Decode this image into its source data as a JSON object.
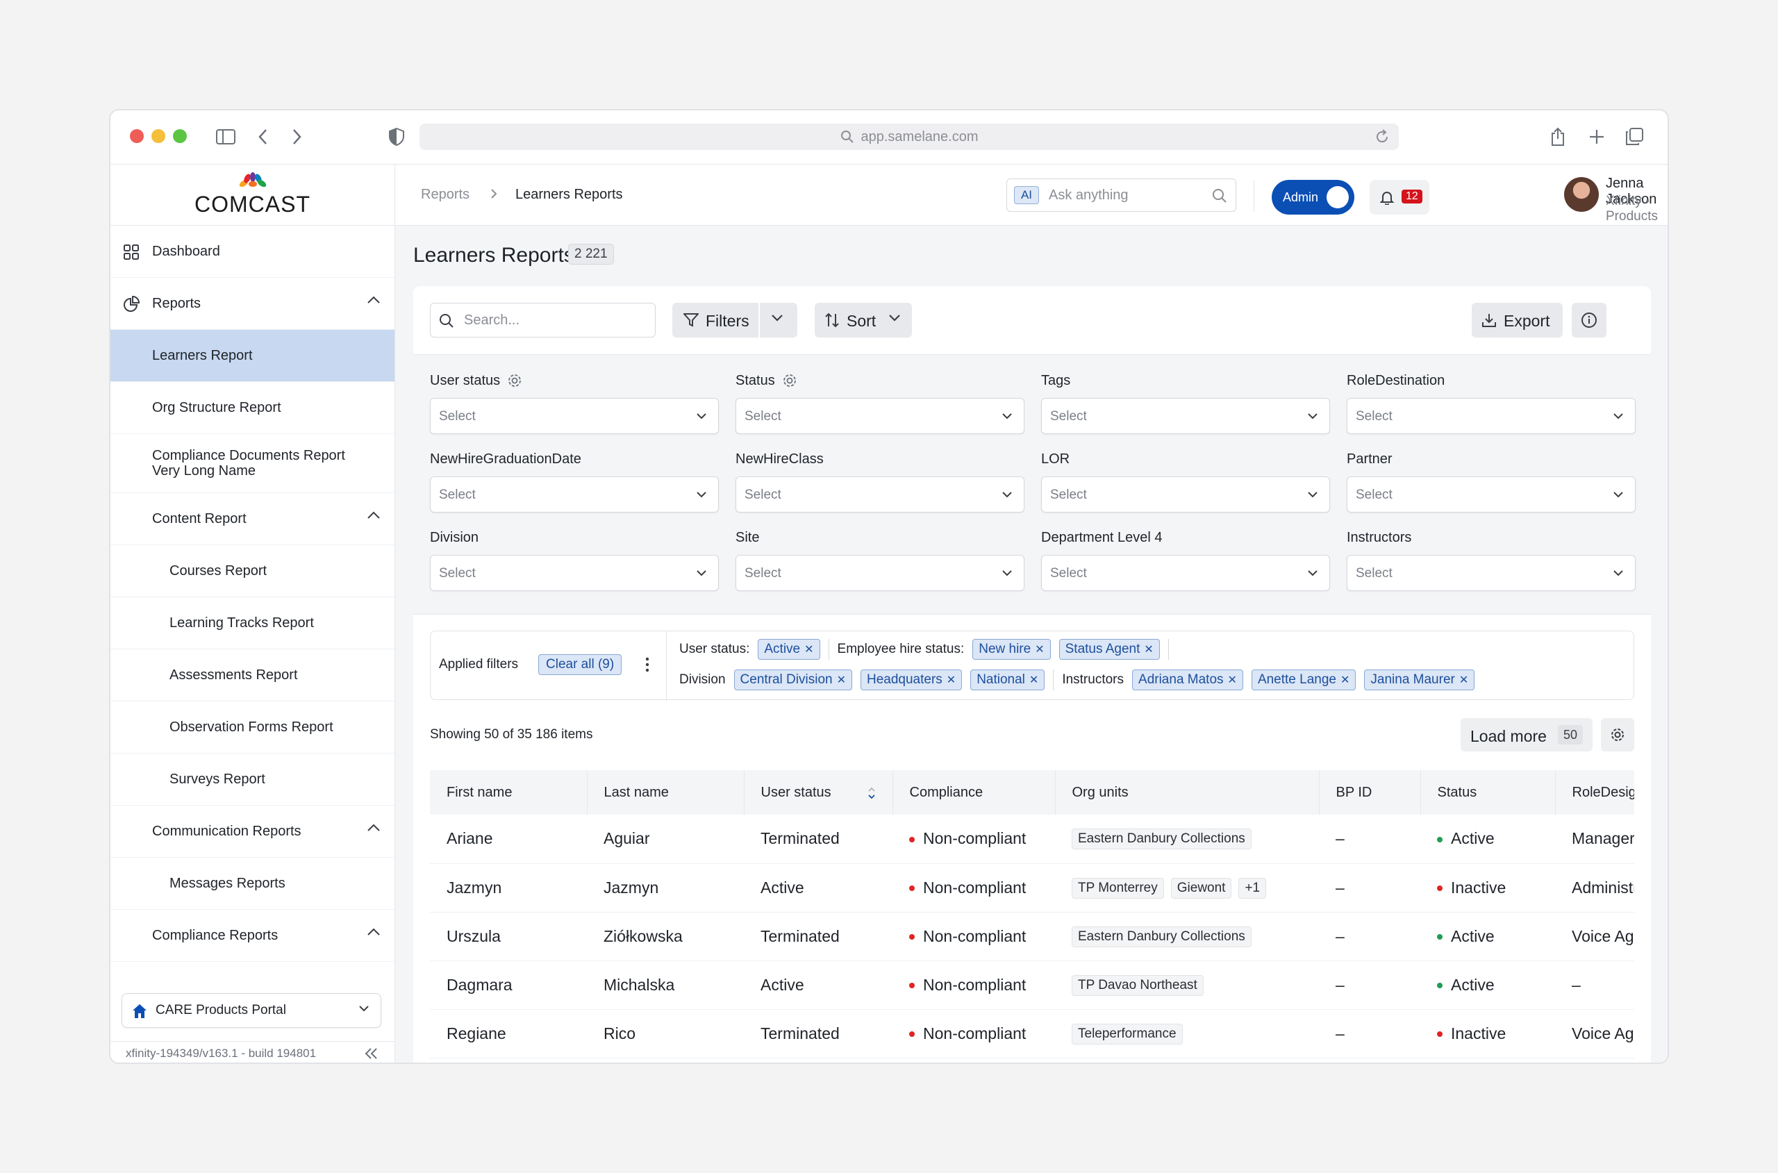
{
  "browser": {
    "url": "app.samelane.com"
  },
  "brand": {
    "logo_text": "COMCAST"
  },
  "sidebar": {
    "items": [
      {
        "label": "Dashboard"
      },
      {
        "label": "Reports"
      },
      {
        "label": "Learners Report"
      },
      {
        "label": "Org Structure Report"
      },
      {
        "label": "Compliance Documents Report Very Long Name"
      },
      {
        "label": "Content Report"
      },
      {
        "label": "Courses Report"
      },
      {
        "label": "Learning Tracks Report"
      },
      {
        "label": "Assessments Report"
      },
      {
        "label": "Observation Forms Report"
      },
      {
        "label": "Surveys Report"
      },
      {
        "label": "Communication Reports"
      },
      {
        "label": "Messages Reports"
      },
      {
        "label": "Compliance Reports"
      }
    ],
    "portal": "CARE Products Portal",
    "build": "xfinity-194349/v163.1 - build 194801"
  },
  "header": {
    "breadcrumb": [
      "Reports",
      "Learners Reports"
    ],
    "ask_placeholder": "Ask anything",
    "ai_badge": "AI",
    "admin_label": "Admin",
    "notifications": "12",
    "user_name": "Jenna Jackson",
    "user_org": "Xfinity - Products"
  },
  "page": {
    "title": "Learners Reports",
    "count": "2 221"
  },
  "toolbar": {
    "search_placeholder": "Search...",
    "filters": "Filters",
    "sort": "Sort",
    "export": "Export"
  },
  "filters": [
    {
      "label": "User status",
      "value": "Select"
    },
    {
      "label": "Status",
      "value": "Select"
    },
    {
      "label": "Tags",
      "value": "Select"
    },
    {
      "label": "RoleDestination",
      "value": "Select"
    },
    {
      "label": "NewHireGraduationDate",
      "value": "Select"
    },
    {
      "label": "NewHireClass",
      "value": "Select"
    },
    {
      "label": "LOR",
      "value": "Select"
    },
    {
      "label": "Partner",
      "value": "Select"
    },
    {
      "label": "Division",
      "value": "Select"
    },
    {
      "label": "Site",
      "value": "Select"
    },
    {
      "label": "Department Level 4",
      "value": "Select"
    },
    {
      "label": "Instructors",
      "value": "Select"
    }
  ],
  "applied": {
    "label": "Applied filters",
    "clear": "Clear all (9)",
    "user_status_key": "User status:",
    "user_status": [
      "Active"
    ],
    "hire_key": "Employee hire status:",
    "hire": [
      "New hire",
      "Status Agent"
    ],
    "division_key": "Division",
    "division": [
      "Central Division",
      "Headquaters",
      "National"
    ],
    "instructors_key": "Instructors",
    "instructors": [
      "Adriana Matos",
      "Anette Lange",
      "Janina Maurer"
    ]
  },
  "results": {
    "showing": "Showing 50 of 35 186 items",
    "load_more": "Load more",
    "load_count": "50"
  },
  "table": {
    "columns": [
      "First name",
      "Last name",
      "User status",
      "Compliance",
      "Org units",
      "BP ID",
      "Status",
      "RoleDesignation"
    ],
    "rows": [
      {
        "first": "Ariane",
        "last": "Aguiar",
        "user_status": "Terminated",
        "compliance": "Non-compliant",
        "org": [
          "Eastern Danbury Collections"
        ],
        "bp": "–",
        "status": "Active",
        "status_color": "#1f9d55",
        "role": "Manager"
      },
      {
        "first": "Jazmyn",
        "last": "Jazmyn",
        "user_status": "Active",
        "compliance": "Non-compliant",
        "org": [
          "TP Monterrey",
          "Giewont",
          "+1"
        ],
        "bp": "–",
        "status": "Inactive",
        "status_color": "#e02424",
        "role": "Administrator"
      },
      {
        "first": "Urszula",
        "last": "Ziółkowska",
        "user_status": "Terminated",
        "compliance": "Non-compliant",
        "org": [
          "Eastern Danbury Collections"
        ],
        "bp": "–",
        "status": "Active",
        "status_color": "#1f9d55",
        "role": "Voice Agent"
      },
      {
        "first": "Dagmara",
        "last": "Michalska",
        "user_status": "Active",
        "compliance": "Non-compliant",
        "org": [
          "TP Davao Northeast"
        ],
        "bp": "–",
        "status": "Active",
        "status_color": "#1f9d55",
        "role": "–"
      },
      {
        "first": "Regiane",
        "last": "Rico",
        "user_status": "Terminated",
        "compliance": "Non-compliant",
        "org": [
          "Teleperformance"
        ],
        "bp": "–",
        "status": "Inactive",
        "status_color": "#e02424",
        "role": "Voice Agent"
      }
    ]
  },
  "colors": {
    "accent": "#0b4fb5",
    "active_nav": "#c7d8f0",
    "noncompliant": "#e02424",
    "active": "#1f9d55"
  }
}
